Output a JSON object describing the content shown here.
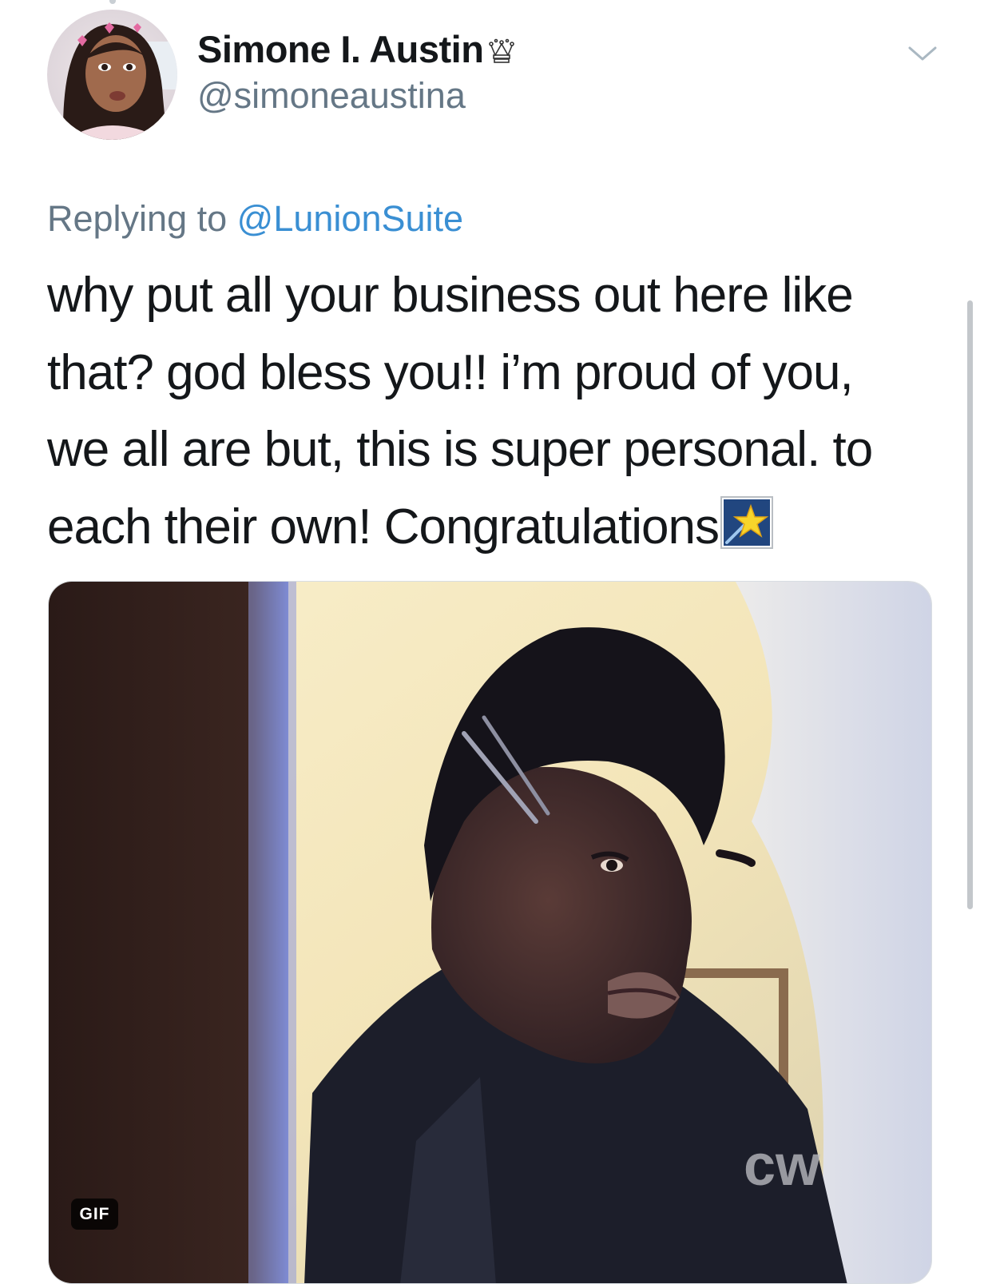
{
  "tweet": {
    "author": {
      "display_name": "Simone I. Austin",
      "name_badge_icon": "crown-icon",
      "handle": "@simoneaustina"
    },
    "reply_prefix": "Replying to",
    "reply_to": "@LunionSuite",
    "text_lines": [
      "why put all your business out here like",
      "that? god bless you!! i’m proud of you,",
      "we all are but, this is super personal. to",
      "each their own! Congratulations"
    ],
    "trailing_emoji": "shooting-star-emoji",
    "media": {
      "type": "gif",
      "badge": "GIF",
      "watermark": "cw"
    }
  },
  "icons": {
    "menu": "chevron-down-icon"
  },
  "colors": {
    "text": "#14171a",
    "secondary": "#657786",
    "link": "#3a8fd3"
  }
}
